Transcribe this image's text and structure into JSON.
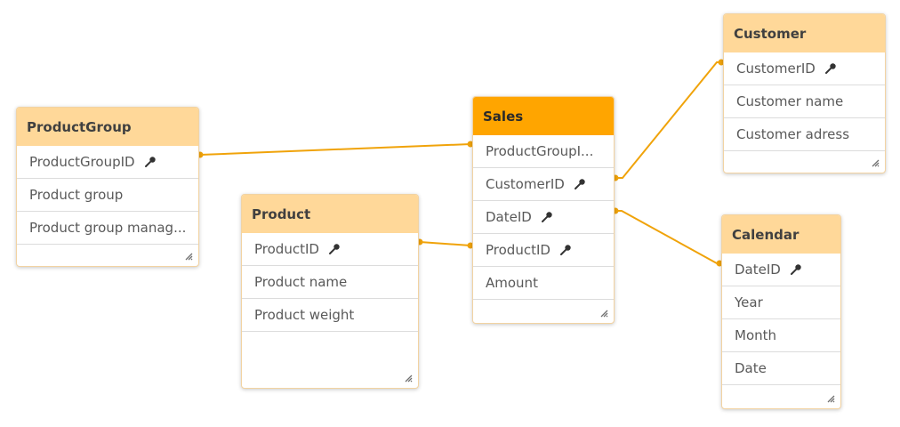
{
  "tables": {
    "productgroup": {
      "title": "ProductGroup",
      "fields": [
        "ProductGroupID",
        "Product group",
        "Product group manag..."
      ]
    },
    "product": {
      "title": "Product",
      "fields": [
        "ProductID",
        "Product name",
        "Product weight"
      ]
    },
    "sales": {
      "title": "Sales",
      "fields": [
        "ProductGroupI...",
        "CustomerID",
        "DateID",
        "ProductID",
        "Amount"
      ]
    },
    "customer": {
      "title": "Customer",
      "fields": [
        "CustomerID",
        "Customer name",
        "Customer adress"
      ]
    },
    "calendar": {
      "title": "Calendar",
      "fields": [
        "DateID",
        "Year",
        "Month",
        "Date"
      ]
    }
  },
  "key_fields": [
    "ProductGroupID",
    "ProductID",
    "CustomerID",
    "DateID"
  ],
  "colors": {
    "link": "#f0a30a",
    "header": "#ffd899",
    "header_active": "#ffa500"
  },
  "relations": [
    {
      "from": "productgroup.ProductGroupID",
      "to": "sales.ProductGroupI..."
    },
    {
      "from": "product.ProductID",
      "to": "sales.ProductID"
    },
    {
      "from": "sales.CustomerID",
      "to": "customer.CustomerID"
    },
    {
      "from": "sales.DateID",
      "to": "calendar.DateID"
    }
  ]
}
